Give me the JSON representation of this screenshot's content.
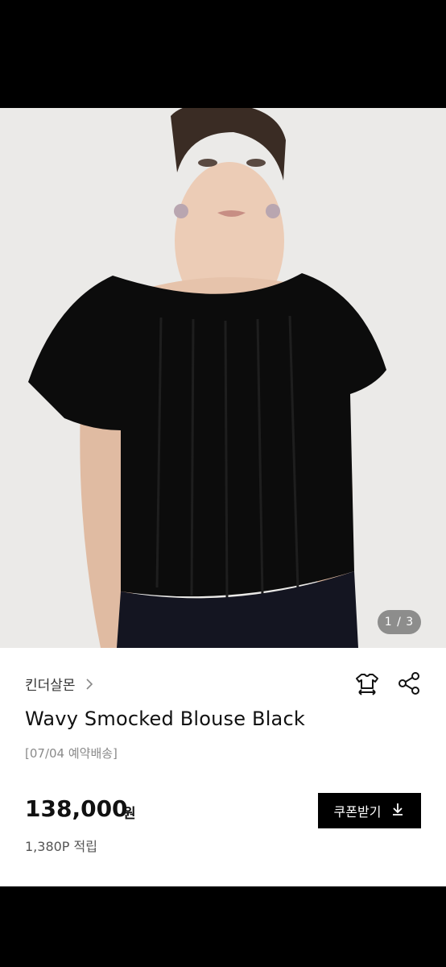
{
  "gallery": {
    "counter": "1 / 3"
  },
  "product": {
    "brand": "킨더살몬",
    "title": "Wavy Smocked Blouse Black",
    "shipping_note": "[07/04 예약배송]",
    "price": "138,000",
    "currency": "원",
    "points": "1,380P 적립"
  },
  "actions": {
    "coupon_label": "쿠폰받기"
  },
  "icons": {
    "brand_chevron": "chevron-right-icon",
    "size_guide": "shirt-size-icon",
    "share": "share-icon",
    "download": "download-icon"
  },
  "colors": {
    "primary": "#000000",
    "text": "#111111",
    "muted": "#8a8a8a"
  }
}
